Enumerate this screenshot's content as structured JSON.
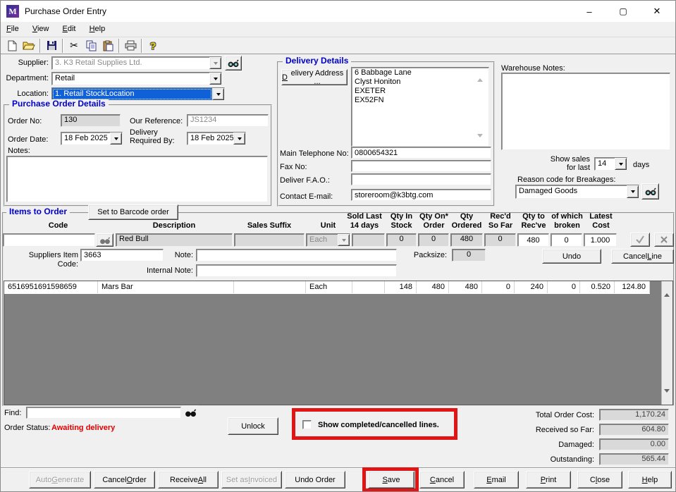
{
  "window": {
    "title": "Purchase Order Entry",
    "icon_letter": "M",
    "controls": {
      "minimize": "–",
      "maximize": "▢",
      "close": "✕"
    }
  },
  "menu": {
    "items": [
      "&File",
      "&View",
      "&Edit",
      "&Help"
    ]
  },
  "toolbar": {
    "icons": [
      "new",
      "open",
      "save",
      "cut",
      "copy",
      "paste",
      "print",
      "help"
    ]
  },
  "header_fields": {
    "supplier_label": "Supplier:",
    "supplier_value": "3.  K3 Retail Supplies Ltd.",
    "department_label": "Department:",
    "department_value": "Retail",
    "location_label": "Location:",
    "location_value": "1. Retail StockLocation"
  },
  "po_details": {
    "title": "Purchase Order Details",
    "order_no_label": "Order No:",
    "order_no": "130",
    "our_reference_label": "Our Reference:",
    "our_reference": "JS1234",
    "order_date_label": "Order Date:",
    "order_date": "18 Feb 2025",
    "delivery_required_label": "Delivery\nRequired By:",
    "delivery_required": "18 Feb 2025",
    "notes_label": "Notes:",
    "notes": ""
  },
  "delivery_details": {
    "title": "Delivery Details",
    "address_button": "&Delivery Address ...",
    "address": "6 Babbage Lane\nClyst Honiton\nEXETER\nEX52FN",
    "phone_label": "Main Telephone No:",
    "phone": "0800654321",
    "fax_label": "Fax No:",
    "fax": "",
    "fao_label": "Deliver F.A.O.:",
    "fao": "",
    "email_label": "Contact E-mail:",
    "email": "storeroom@k3btg.com"
  },
  "warehouse": {
    "notes_label": "Warehouse Notes:",
    "notes": "",
    "show_sales_label": "Show sales\nfor last",
    "show_sales_days": "14",
    "days_suffix": "days",
    "breakages_label": "Reason code for Breakages:",
    "breakages_value": "Damaged Goods"
  },
  "items": {
    "title": "Items to Order",
    "barcode_button": "Set to Barcode order",
    "headers": [
      "Code",
      "Description",
      "Sales Suffix",
      "Unit",
      "Sold Last\n14 days",
      "Qty In\nStock",
      "Qty On*\nOrder",
      "Qty\nOrdered",
      "Rec'd\nSo Far",
      "Qty to\nRec've",
      "of which\nbroken",
      "Latest\nCost"
    ],
    "entry": {
      "code": "",
      "description": "Red Bull",
      "sales_suffix": "",
      "unit": "Each",
      "sold_last": "",
      "qty_in_stock": "0",
      "qty_on_order": "0",
      "qty_ordered": "480",
      "recd_so_far": "0",
      "qty_to_receive": "480",
      "of_which_broken": "0",
      "latest_cost": "1.000"
    },
    "suppliers_item_code_label": "Suppliers Item Code:",
    "suppliers_item_code": "3663",
    "note_label": "Note:",
    "note": "",
    "internal_note_label": "Internal Note:",
    "internal_note": "",
    "packsize_label": "Packsize:",
    "packsize": "0",
    "undo_button": "Undo",
    "cancel_line_button": "Cancel &Line",
    "grid_row": {
      "code": "6516951691598659",
      "description": "Mars Bar",
      "sales_suffix": "",
      "unit": "Each",
      "sold_last": "",
      "qty_in_stock": "148",
      "qty_on_order": "480",
      "qty_ordered": "480",
      "recd_so_far": "0",
      "qty_to_receive": "240",
      "of_which_broken": "0",
      "latest_cost": "0.520",
      "line_total": "124.80"
    }
  },
  "footer": {
    "find_label": "Find:",
    "find_value": "",
    "order_status_label": "Order Status:",
    "order_status": "Awaiting delivery",
    "unlock_button": "Unlock",
    "show_completed_label": "Show completed/cancelled lines.",
    "totals": [
      {
        "label": "Total Order Cost:",
        "value": "1,170.24"
      },
      {
        "label": "Received so Far:",
        "value": "604.80"
      },
      {
        "label": "Damaged:",
        "value": "0.00"
      },
      {
        "label": "Outstanding:",
        "value": "565.44"
      }
    ]
  },
  "buttons": [
    {
      "label": "Auto &Generate",
      "disabled": true
    },
    {
      "label": "Cancel &Order",
      "disabled": false
    },
    {
      "label": "Receive &All",
      "disabled": false
    },
    {
      "label": "Set as &Invoiced",
      "disabled": true
    },
    {
      "label": "Undo Order",
      "disabled": false
    },
    {
      "label": "&Save",
      "disabled": false
    },
    {
      "label": "&Cancel",
      "disabled": false
    },
    {
      "label": "&Email",
      "disabled": false
    },
    {
      "label": "&Print",
      "disabled": false
    },
    {
      "label": "C&lose",
      "disabled": false
    },
    {
      "label": "&Help",
      "disabled": false
    }
  ],
  "colors": {
    "group_title": "#0000cc",
    "selection_bg": "#1060d8",
    "status_red": "#e00000",
    "annotation_red": "#e01515",
    "row_marker_yellow": "#ffff00"
  }
}
